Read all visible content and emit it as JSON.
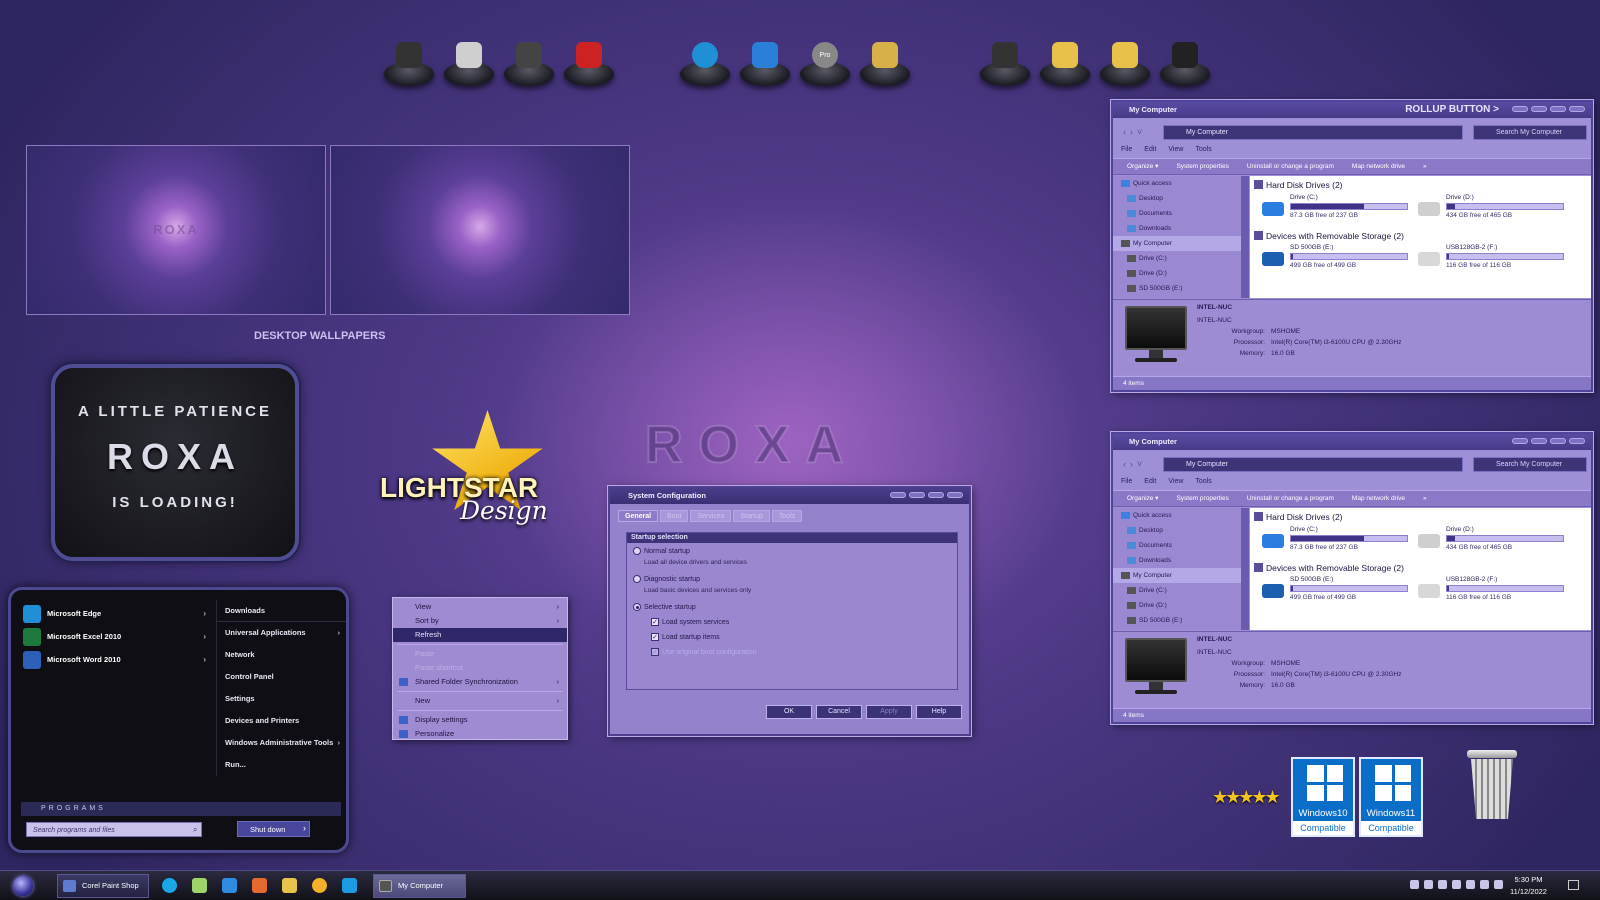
{
  "dock": {
    "group1": [
      "monitor-icon",
      "documents-icon",
      "control-panel-icon",
      "checklist-icon"
    ],
    "group2": [
      "edge-icon",
      "mail-icon",
      "pro-disc-icon",
      "folder-note-icon"
    ],
    "group3": [
      "apps-grid-icon",
      "folder-icon",
      "folder-icon",
      "rubik-icon"
    ],
    "pro_label": "Pro"
  },
  "wallpapers": {
    "caption": "DESKTOP WALLPAPERS",
    "watermark": "ROXA"
  },
  "loading_card": {
    "line1": "A LITTLE PATIENCE",
    "line2": "ROXA",
    "line3": "IS LOADING!"
  },
  "logo": {
    "text1": "LIGHTSTAR",
    "text2": "Design"
  },
  "center_watermark": "ROXA",
  "start_menu": {
    "pinned": [
      {
        "label": "Microsoft Edge",
        "icon": "edge-icon",
        "color": "#1f8fd6"
      },
      {
        "label": "Microsoft Excel 2010",
        "icon": "excel-icon",
        "color": "#1d7a3c"
      },
      {
        "label": "Microsoft Word 2010",
        "icon": "word-icon",
        "color": "#2b5fb8"
      }
    ],
    "right": [
      {
        "label": "Downloads",
        "arrow": false
      },
      {
        "label": "Universal Applications",
        "arrow": true
      },
      {
        "label": "Network",
        "arrow": false
      },
      {
        "label": "Control Panel",
        "arrow": false
      },
      {
        "label": "Settings",
        "arrow": false
      },
      {
        "label": "Devices and Printers",
        "arrow": false
      },
      {
        "label": "Windows Administrative Tools",
        "arrow": true
      },
      {
        "label": "Run...",
        "arrow": false
      }
    ],
    "programs_label": "PROGRAMS",
    "search_placeholder": "Search programs and files",
    "shutdown_label": "Shut down"
  },
  "context_menu": {
    "items": [
      {
        "label": "View",
        "arrow": true,
        "state": "normal"
      },
      {
        "label": "Sort by",
        "arrow": true,
        "state": "normal"
      },
      {
        "label": "Refresh",
        "arrow": false,
        "state": "selected"
      },
      {
        "sep": true
      },
      {
        "label": "Paste",
        "arrow": false,
        "state": "disabled"
      },
      {
        "label": "Paste shortcut",
        "arrow": false,
        "state": "disabled"
      },
      {
        "label": "Shared Folder Synchronization",
        "arrow": true,
        "state": "normal",
        "icon": true
      },
      {
        "sep": true
      },
      {
        "label": "New",
        "arrow": true,
        "state": "normal"
      },
      {
        "sep": true
      },
      {
        "label": "Display settings",
        "arrow": false,
        "state": "normal",
        "icon": true
      },
      {
        "label": "Personalize",
        "arrow": false,
        "state": "normal",
        "icon": true
      }
    ]
  },
  "sysconfig": {
    "title": "System Configuration",
    "tabs": [
      "General",
      "Boot",
      "Services",
      "Startup",
      "Tools"
    ],
    "group_title": "Startup selection",
    "normal": "Normal startup",
    "normal_desc": "Load all device drivers and services",
    "diagnostic": "Diagnostic startup",
    "diagnostic_desc": "Load basic devices and services only",
    "selective": "Selective startup",
    "opt1": "Load system services",
    "opt2": "Load startup items",
    "opt3": "Use original boot configuration",
    "buttons": {
      "ok": "OK",
      "cancel": "Cancel",
      "apply": "Apply",
      "help": "Help"
    }
  },
  "explorer": {
    "title": "My Computer",
    "rollup": "ROLLUP BUTTON >",
    "address": "My Computer",
    "search": "Search My Computer",
    "menu": [
      "File",
      "Edit",
      "View",
      "Tools"
    ],
    "commands": [
      "Organize ▾",
      "System properties",
      "Uninstall or change a program",
      "Map network drive",
      "»"
    ],
    "tree_quick": [
      "Quick access",
      "Desktop",
      "Documents",
      "Downloads"
    ],
    "tree_pc": [
      "My Computer",
      "Drive (C:)",
      "Drive (D:)",
      "SD 500GB (E:)"
    ],
    "group_hdd": "Hard Disk Drives (2)",
    "group_removable": "Devices with Removable Storage (2)",
    "drives": [
      {
        "name": "Drive (C:)",
        "free": "87.3 GB free of 237 GB",
        "used": 0.63,
        "icon": "windows-drive-icon"
      },
      {
        "name": "Drive (D:)",
        "free": "434 GB free of 465 GB",
        "used": 0.07,
        "icon": "hdd-icon"
      },
      {
        "name": "SD 500GB (E:)",
        "free": "499 GB free of 499 GB",
        "used": 0.0,
        "icon": "sd-card-icon"
      },
      {
        "name": "USB128GB-2 (F:)",
        "free": "116 GB free of 116 GB",
        "used": 0.0,
        "icon": "usb-drive-icon"
      }
    ],
    "pc_name": "INTEL-NUC",
    "pc_sub": "INTEL-NUC",
    "workgroup_label": "Workgroup:",
    "workgroup": "MSHOME",
    "processor_label": "Processor:",
    "processor": "Intel(R) Core(TM) i3-6100U CPU @ 2.30GHz",
    "memory_label": "Memory:",
    "memory": "16.0 GB",
    "status": "4 items"
  },
  "badges": {
    "win10": "Windows10",
    "win11": "Windows11",
    "compatible": "Compatible",
    "stars": "★★★★★"
  },
  "taskbar": {
    "buttons": [
      {
        "label": "Corel Paint Shop P...",
        "color": "#5e7bd0"
      },
      {
        "label": "My Computer",
        "color": "#666"
      }
    ],
    "pins": [
      {
        "icon": "cortana-icon",
        "color": "#1aa7e8"
      },
      {
        "icon": "onedrive-icon",
        "color": "#9ed36a"
      },
      {
        "icon": "stack-icon",
        "color": "#2f8de0"
      },
      {
        "icon": "windows-icon",
        "color": "#e46a2e"
      },
      {
        "icon": "media-icon",
        "color": "#e8c24a"
      },
      {
        "icon": "chrome-icon",
        "color": "#f3b12b"
      },
      {
        "icon": "skype-icon",
        "color": "#1d9be2"
      }
    ],
    "time": "5:30 PM",
    "date": "11/12/2022"
  }
}
